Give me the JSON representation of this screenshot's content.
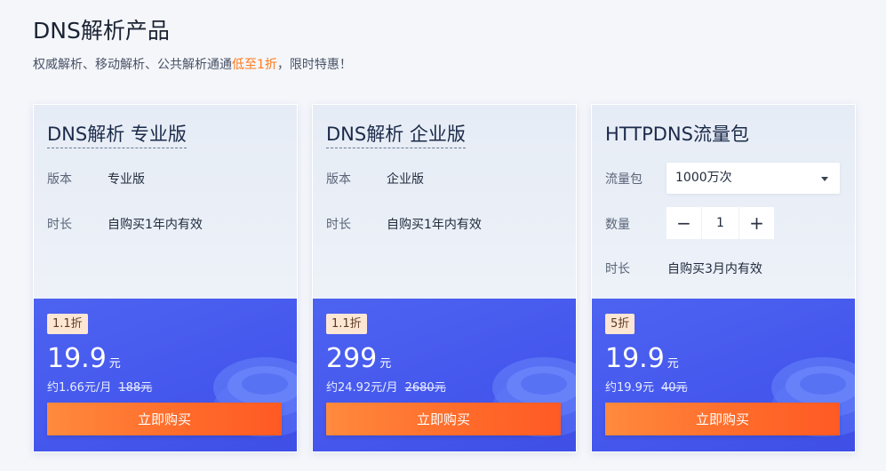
{
  "header": {
    "title": "DNS解析产品",
    "subtitle_before": "权威解析、移动解析、公共解析通通",
    "subtitle_highlight": "低至1折",
    "subtitle_after": "，限时特惠！"
  },
  "colors": {
    "accent_orange": "#ff7a1a",
    "price_bg": "#4659ee",
    "button_orange": "#ff6a2a"
  },
  "cards": [
    {
      "title": "DNS解析 专业版",
      "rows": [
        {
          "label": "版本",
          "value": "专业版"
        },
        {
          "label": "时长",
          "value": "自购买1年内有效"
        }
      ],
      "badge": "1.1折",
      "price": "19.9",
      "unit": "元",
      "monthly": "约1.66元/月",
      "original": "188元",
      "button": "立即购买"
    },
    {
      "title": "DNS解析 企业版",
      "rows": [
        {
          "label": "版本",
          "value": "企业版"
        },
        {
          "label": "时长",
          "value": "自购买1年内有效"
        }
      ],
      "badge": "1.1折",
      "price": "299",
      "unit": "元",
      "monthly": "约24.92元/月",
      "original": "2680元",
      "button": "立即购买"
    },
    {
      "title": "HTTPDNS流量包",
      "traffic_label": "流量包",
      "traffic_value": "1000万次",
      "qty_label": "数量",
      "qty_minus": "−",
      "qty_value": "1",
      "qty_plus": "+",
      "duration_label": "时长",
      "duration_value": "自购买3月内有效",
      "badge": "5折",
      "price": "19.9",
      "unit": "元",
      "monthly": "约19.9元",
      "original": "40元",
      "button": "立即购买"
    }
  ]
}
